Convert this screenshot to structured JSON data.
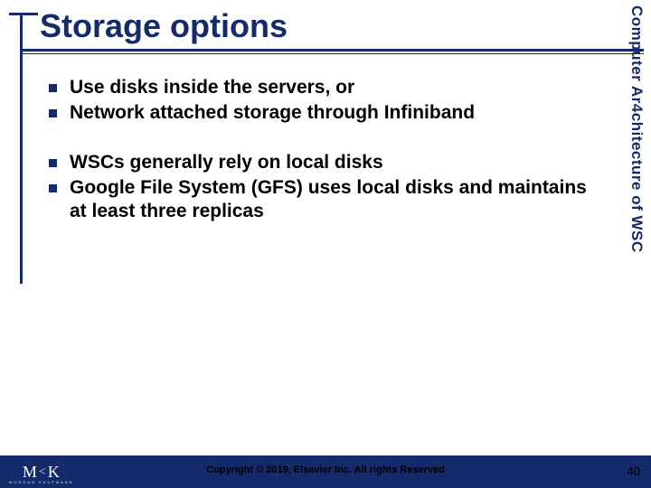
{
  "title": "Storage options",
  "sidebar": "Computer Ar4chitecture of WSC",
  "groups": [
    {
      "items": [
        "Use disks inside the servers, or",
        "Network attached storage through Infiniband"
      ]
    },
    {
      "items": [
        "WSCs generally rely on local disks",
        "Google File System (GFS) uses local disks and maintains at least three replicas"
      ]
    }
  ],
  "footer": {
    "logo_main": "M〈K",
    "logo_sub": "MORGAN KAUFMANN",
    "copyright": "Copyright © 2019, Elsevier Inc. All rights Reserved",
    "page": "40"
  }
}
